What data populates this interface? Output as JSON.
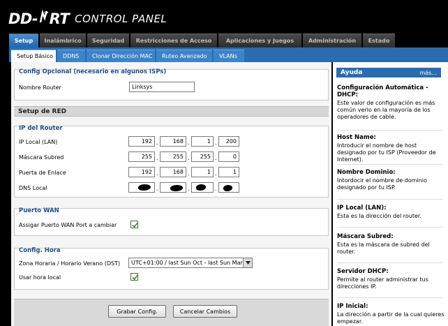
{
  "header": {
    "logo_dd": "DD",
    "logo_rt": "RT",
    "logo_cp": "CONTROL PANEL"
  },
  "main_tabs": [
    {
      "label": "Setup",
      "active": true
    },
    {
      "label": "Inalámbrico"
    },
    {
      "label": "Seguridad"
    },
    {
      "label": "Restricciones de Acceso"
    },
    {
      "label": "Aplicaciones y Juegos"
    },
    {
      "label": "Administración"
    },
    {
      "label": "Estado"
    }
  ],
  "sub_tabs": [
    {
      "label": "Setup Básico",
      "active": true
    },
    {
      "label": "DDNS"
    },
    {
      "label": "Clonar Dirección MAC"
    },
    {
      "label": "Ruteo Avanzado"
    },
    {
      "label": "VLANs"
    }
  ],
  "optional": {
    "legend": "Config Opcional (necesario en algunos ISPs)",
    "router_name_label": "Nombre Router",
    "router_name_value": "Linksys"
  },
  "network": {
    "section_title": "Setup de RED",
    "legend": "IP del Router",
    "local_ip_label": "IP Local (LAN)",
    "local_ip": [
      "192",
      "168",
      "1",
      "200"
    ],
    "subnet_label": "Máscara Subred",
    "subnet": [
      "255",
      "255",
      "255",
      "0"
    ],
    "gateway_label": "Puerta de Enlace",
    "gateway": [
      "192",
      "168",
      "1",
      "1"
    ],
    "dns_label": "DNS Local",
    "dot": "."
  },
  "wan": {
    "legend": "Puerto WAN",
    "assign_label": "Assigar Puerto WAN Port a cambiar",
    "assign_checked": true
  },
  "time": {
    "legend": "Config. Hora",
    "zone_label": "Zona Horaria / Horario Verano (DST)",
    "zone_value": "UTC+01:00 / last Sun Oct - last Sun Mar",
    "local_time_label": "Usar hora local",
    "local_time_checked": true
  },
  "buttons": {
    "save": "Grabar Config.",
    "cancel": "Cancelar Cambios"
  },
  "help": {
    "title": "Ayuda",
    "more": "más...",
    "items": [
      {
        "title": "Configuración Automática - DHCP:",
        "desc": "Este valor de configuración es más común verlo en la mayoría de los operadores de cable."
      },
      {
        "title": "Host Name:",
        "desc": "Introducir el nombre de host designado por tu ISP (Proveedor de Internet)."
      },
      {
        "title": "Nombre Dominio:",
        "desc": "Intordocir el nombre de dominio designado por tu ISP."
      },
      {
        "title": "IP Local (LAN):",
        "desc": "Esta es la dirección del router."
      },
      {
        "title": "Máscara Subred:",
        "desc": "Esta es la máscara de subred del router."
      },
      {
        "title": "Servidor DHCP:",
        "desc": "Permite al router administrar tus direcciones IP."
      },
      {
        "title": "IP Inicial:",
        "desc": "La dirección a partir de la cual quieres empezar."
      }
    ]
  },
  "colors": {
    "accent": "#2a6bb1",
    "legend": "#1f4e8c",
    "check": "#3a8a2a"
  }
}
